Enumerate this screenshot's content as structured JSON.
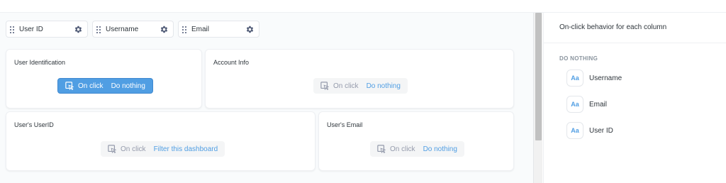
{
  "columns": [
    {
      "label": "User ID"
    },
    {
      "label": "Username"
    },
    {
      "label": "Email"
    }
  ],
  "cards": [
    {
      "title": "User Identification",
      "on_click": "On click",
      "action": "Do nothing"
    },
    {
      "title": "Account Info",
      "on_click": "On click",
      "action": "Do nothing"
    },
    {
      "title": "User's UserID",
      "on_click": "On click",
      "action": "Filter this dashboard"
    },
    {
      "title": "User's Email",
      "on_click": "On click",
      "action": "Do nothing"
    }
  ],
  "sidebar": {
    "title": "On-click behavior for each column",
    "section": "DO NOTHING",
    "items": [
      {
        "icon": "Aa",
        "label": "Username"
      },
      {
        "icon": "Aa",
        "label": "Email"
      },
      {
        "icon": "Aa",
        "label": "User ID"
      }
    ]
  },
  "colors": {
    "brand": "#509ee3",
    "text": "#2e353b",
    "muted": "#949aab"
  }
}
